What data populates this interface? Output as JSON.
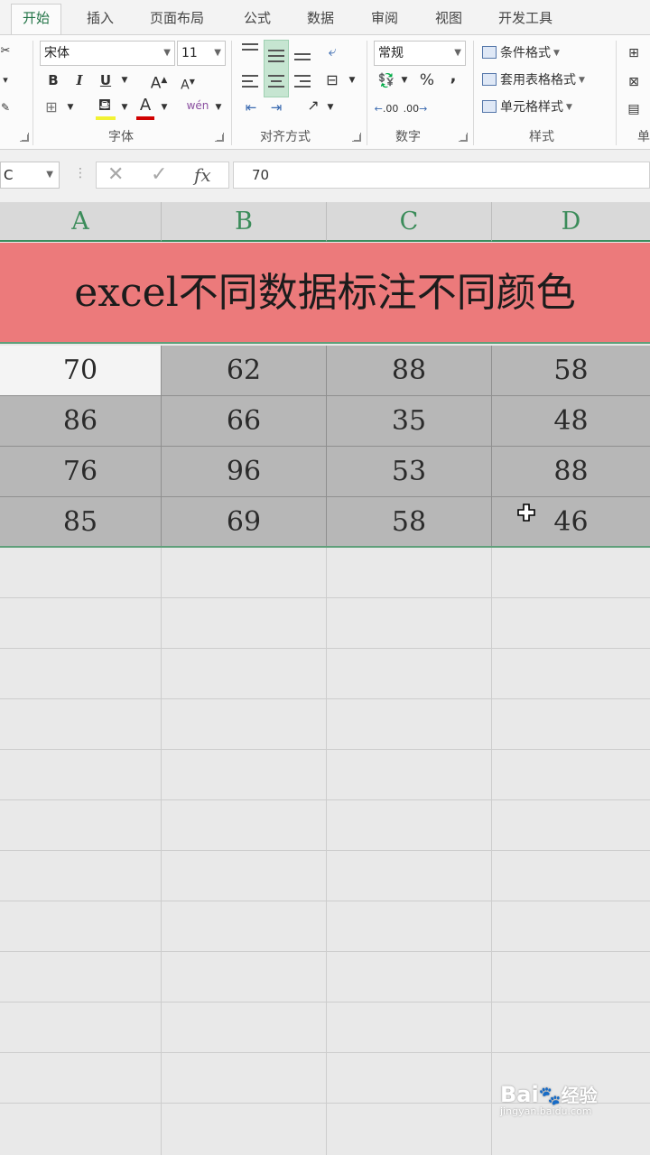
{
  "ribbon": {
    "tabs": [
      "开始",
      "插入",
      "页面布局",
      "公式",
      "数据",
      "审阅",
      "视图",
      "开发工具"
    ],
    "font": {
      "name": "宋体",
      "size": "11",
      "bold": "B",
      "italic": "I",
      "underline": "U",
      "grow": "A",
      "shrink": "A",
      "font_color": "A",
      "phonetic": "wén",
      "label": "字体"
    },
    "alignment": {
      "label": "对齐方式"
    },
    "number": {
      "format": "常规",
      "percent": "%",
      "comma": ",",
      "inc_decimal": ".00",
      "dec_decimal": ".00",
      "label": "数字"
    },
    "styles": {
      "conditional": "条件格式",
      "table": "套用表格格式",
      "cell": "单元格样式",
      "label": "样式"
    },
    "cells_group_label_partial": "单"
  },
  "formula_bar": {
    "name_box": "C",
    "fx": "fx",
    "value": "70"
  },
  "sheet": {
    "columns": [
      "A",
      "B",
      "C",
      "D"
    ],
    "title": "excel不同数据标注不同颜色",
    "rows": [
      [
        "70",
        "62",
        "88",
        "58"
      ],
      [
        "86",
        "66",
        "35",
        "48"
      ],
      [
        "76",
        "96",
        "53",
        "88"
      ],
      [
        "85",
        "69",
        "58",
        "46"
      ]
    ]
  },
  "watermark": {
    "brand": "Bai",
    "brand2": "经验",
    "url": "jingyan.baidu.com"
  },
  "colors": {
    "accent": "#217346",
    "title_fill": "#ec7a7b",
    "data_fill": "#b7b7b7",
    "header_text": "#3b8c5a"
  }
}
